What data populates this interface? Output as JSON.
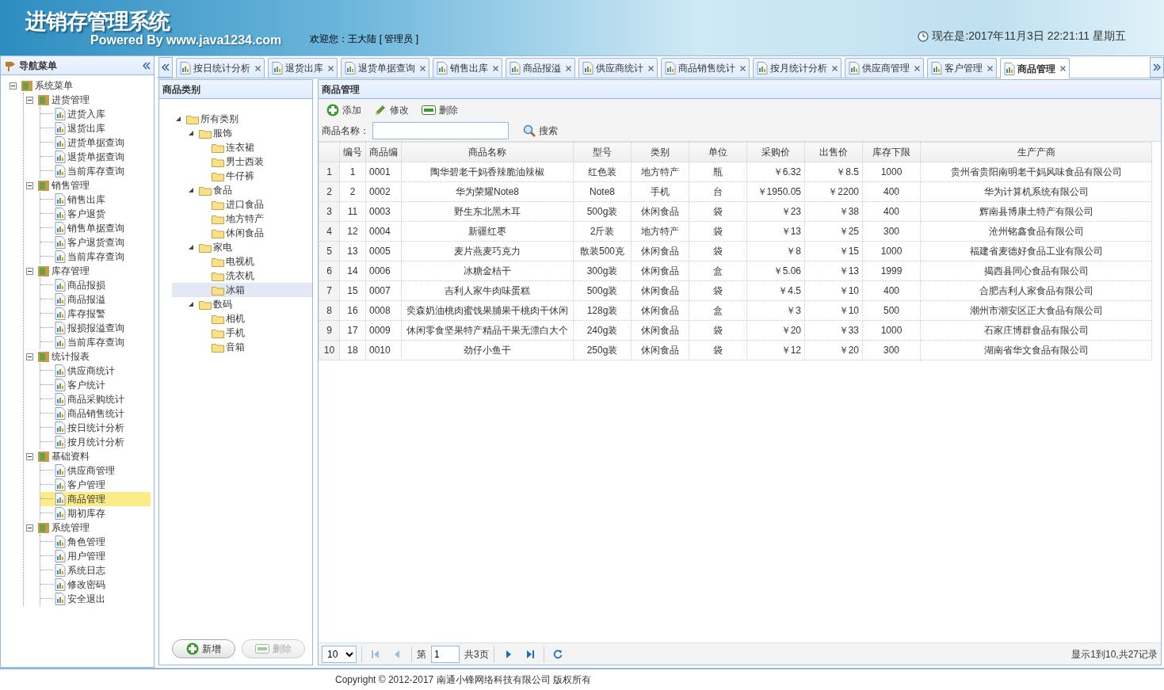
{
  "header": {
    "title": "进销存管理系统",
    "subtitle": "Powered By www.java1234.com",
    "welcome": "欢迎您：王大陆 [ 管理员 ]",
    "clock": "现在是:2017年11月3日 22:21:11 星期五"
  },
  "nav": {
    "title": "导航菜单",
    "tree": [
      {
        "label": "系统菜单",
        "expanded": true,
        "children": [
          {
            "label": "进货管理",
            "expanded": true,
            "children": [
              {
                "label": "进货入库",
                "selected": false
              },
              {
                "label": "退货出库",
                "selected": false
              },
              {
                "label": "进货单据查询",
                "selected": false
              },
              {
                "label": "退货单据查询",
                "selected": false
              },
              {
                "label": "当前库存查询",
                "selected": false
              }
            ]
          },
          {
            "label": "销售管理",
            "expanded": true,
            "children": [
              {
                "label": "销售出库",
                "selected": false
              },
              {
                "label": "客户退货",
                "selected": false
              },
              {
                "label": "销售单据查询",
                "selected": false
              },
              {
                "label": "客户退货查询",
                "selected": false
              },
              {
                "label": "当前库存查询",
                "selected": false
              }
            ]
          },
          {
            "label": "库存管理",
            "expanded": true,
            "children": [
              {
                "label": "商品报损",
                "selected": false
              },
              {
                "label": "商品报溢",
                "selected": false
              },
              {
                "label": "库存报警",
                "selected": false
              },
              {
                "label": "报损报溢查询",
                "selected": false
              },
              {
                "label": "当前库存查询",
                "selected": false
              }
            ]
          },
          {
            "label": "统计报表",
            "expanded": true,
            "children": [
              {
                "label": "供应商统计",
                "selected": false
              },
              {
                "label": "客户统计",
                "selected": false
              },
              {
                "label": "商品采购统计",
                "selected": false
              },
              {
                "label": "商品销售统计",
                "selected": false
              },
              {
                "label": "按日统计分析",
                "selected": false
              },
              {
                "label": "按月统计分析",
                "selected": false
              }
            ]
          },
          {
            "label": "基础资料",
            "expanded": true,
            "children": [
              {
                "label": "供应商管理",
                "selected": false
              },
              {
                "label": "客户管理",
                "selected": false
              },
              {
                "label": "商品管理",
                "selected": true
              },
              {
                "label": "期初库存",
                "selected": false
              }
            ]
          },
          {
            "label": "系统管理",
            "expanded": true,
            "children": [
              {
                "label": "角色管理",
                "selected": false
              },
              {
                "label": "用户管理",
                "selected": false
              },
              {
                "label": "系统日志",
                "selected": false
              },
              {
                "label": "修改密码",
                "selected": false
              },
              {
                "label": "安全退出",
                "selected": false
              }
            ]
          }
        ]
      }
    ]
  },
  "tabs": [
    {
      "label": "按日统计分析",
      "selected": false
    },
    {
      "label": "退货出库",
      "selected": false
    },
    {
      "label": "退货单据查询",
      "selected": false
    },
    {
      "label": "销售出库",
      "selected": false
    },
    {
      "label": "商品报溢",
      "selected": false
    },
    {
      "label": "供应商统计",
      "selected": false
    },
    {
      "label": "商品销售统计",
      "selected": false
    },
    {
      "label": "按月统计分析",
      "selected": false
    },
    {
      "label": "供应商管理",
      "selected": false
    },
    {
      "label": "客户管理",
      "selected": false
    },
    {
      "label": "商品管理",
      "selected": true
    }
  ],
  "category_panel": {
    "title": "商品类别",
    "tree": [
      {
        "label": "所有类别",
        "expanded": true,
        "children": [
          {
            "label": "服饰",
            "expanded": true,
            "children": [
              {
                "label": "连衣裙",
                "selected": false
              },
              {
                "label": "男士西装",
                "selected": false
              },
              {
                "label": "牛仔裤",
                "selected": false
              }
            ]
          },
          {
            "label": "食品",
            "expanded": true,
            "children": [
              {
                "label": "进口食品",
                "selected": false
              },
              {
                "label": "地方特产",
                "selected": false
              },
              {
                "label": "休闲食品",
                "selected": false
              }
            ]
          },
          {
            "label": "家电",
            "expanded": true,
            "children": [
              {
                "label": "电视机",
                "selected": false
              },
              {
                "label": "洗衣机",
                "selected": false
              },
              {
                "label": "冰箱",
                "selected": true
              }
            ]
          },
          {
            "label": "数码",
            "expanded": true,
            "children": [
              {
                "label": "相机",
                "selected": false
              },
              {
                "label": "手机",
                "selected": false
              },
              {
                "label": "音箱",
                "selected": false
              }
            ]
          }
        ]
      }
    ],
    "buttons": [
      {
        "label": "新增",
        "kind": "add",
        "disabled": false
      },
      {
        "label": "删除",
        "kind": "remove",
        "disabled": true
      }
    ]
  },
  "product_panel": {
    "title": "商品管理",
    "toolbar": [
      {
        "label": "添加",
        "kind": "add"
      },
      {
        "label": "修改",
        "kind": "edit"
      },
      {
        "label": "删除",
        "kind": "remove"
      }
    ],
    "search_label": "商品名称：",
    "search_button": "搜索",
    "table": {
      "columns": [
        "编号",
        "商品编",
        "商品名称",
        "型号",
        "类别",
        "单位",
        "采购价",
        "出售价",
        "库存下限",
        "生产产商"
      ],
      "rows": [
        {
          "row_number": "1",
          "cells": [
            "1",
            "0001",
            "陶华碧老干妈香辣脆油辣椒",
            "红色装",
            "地方特产",
            "瓶",
            "￥6.32",
            "￥8.5",
            "1000",
            "贵州省贵阳南明老干妈风味食品有限公司"
          ]
        },
        {
          "row_number": "2",
          "cells": [
            "2",
            "0002",
            "华为荣耀Note8",
            "Note8",
            "手机",
            "台",
            "￥1950.05",
            "￥2200",
            "400",
            "华为计算机系统有限公司"
          ]
        },
        {
          "row_number": "3",
          "cells": [
            "11",
            "0003",
            "野生东北黑木耳",
            "500g装",
            "休闲食品",
            "袋",
            "￥23",
            "￥38",
            "400",
            "辉南县博康土特产有限公司"
          ]
        },
        {
          "row_number": "4",
          "cells": [
            "12",
            "0004",
            "新疆红枣",
            "2斤装",
            "地方特产",
            "袋",
            "￥13",
            "￥25",
            "300",
            "沧州铭鑫食品有限公司"
          ]
        },
        {
          "row_number": "5",
          "cells": [
            "13",
            "0005",
            "麦片燕麦巧克力",
            "散装500克",
            "休闲食品",
            "袋",
            "￥8",
            "￥15",
            "1000",
            "福建省麦德好食品工业有限公司"
          ]
        },
        {
          "row_number": "6",
          "cells": [
            "14",
            "0006",
            "冰糖金桔干",
            "300g装",
            "休闲食品",
            "盒",
            "￥5.06",
            "￥13",
            "1999",
            "揭西县同心食品有限公司"
          ]
        },
        {
          "row_number": "7",
          "cells": [
            "15",
            "0007",
            "吉利人家牛肉味蛋糕",
            "500g装",
            "休闲食品",
            "袋",
            "￥4.5",
            "￥10",
            "400",
            "合肥吉利人家食品有限公司"
          ]
        },
        {
          "row_number": "8",
          "cells": [
            "16",
            "0008",
            "奕森奶油桃肉蜜饯果脯果干桃肉干休闲",
            "128g装",
            "休闲食品",
            "盒",
            "￥3",
            "￥10",
            "500",
            "潮州市潮安区正大食品有限公司"
          ]
        },
        {
          "row_number": "9",
          "cells": [
            "17",
            "0009",
            "休闲零食坚果特产精品干果无漂白大个",
            "240g装",
            "休闲食品",
            "袋",
            "￥20",
            "￥33",
            "1000",
            "石家庄博群食品有限公司"
          ]
        },
        {
          "row_number": "10",
          "cells": [
            "18",
            "0010",
            "劲仔小鱼干",
            "250g装",
            "休闲食品",
            "袋",
            "￥12",
            "￥20",
            "300",
            "湖南省华文食品有限公司"
          ]
        }
      ]
    },
    "pager": {
      "page_size": "10",
      "page_prefix": "第",
      "page": "1",
      "page_total": "共3页",
      "summary": "显示1到10,共27记录",
      "nav_buttons": [
        {
          "kind": "first",
          "disabled": true
        },
        {
          "kind": "prev",
          "disabled": true
        },
        {
          "kind": "next",
          "disabled": false
        },
        {
          "kind": "last",
          "disabled": false
        },
        {
          "kind": "refresh",
          "disabled": false
        }
      ]
    }
  },
  "footer": "Copyright © 2012-2017 南通小锋网络科技有限公司 版权所有"
}
